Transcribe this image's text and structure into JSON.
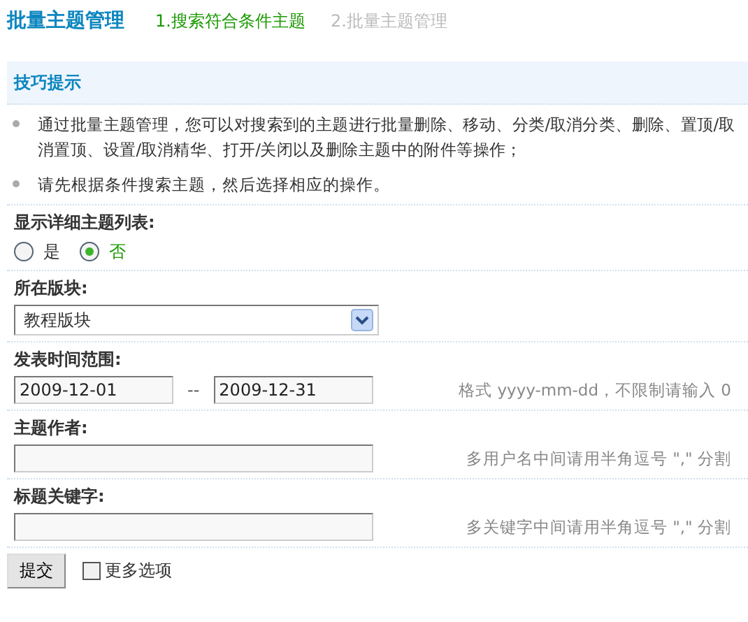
{
  "header": {
    "title": "批量主题管理",
    "steps": [
      {
        "label": "1.搜索符合条件主题",
        "selected": true
      },
      {
        "label": "2.批量主题管理",
        "selected": false
      }
    ]
  },
  "tips": {
    "title": "技巧提示",
    "items": [
      "通过批量主题管理，您可以对搜索到的主题进行批量删除、移动、分类/取消分类、删除、置顶/取消置顶、设置/取消精华、打开/关闭以及删除主题中的附件等操作；",
      "请先根据条件搜索主题，然后选择相应的操作。"
    ]
  },
  "form": {
    "detail_list": {
      "label": "显示详细主题列表:",
      "options": [
        {
          "label": "是",
          "selected": false
        },
        {
          "label": "否",
          "selected": true
        }
      ]
    },
    "forum": {
      "label": "所在版块:",
      "value": "教程版块"
    },
    "date_range": {
      "label": "发表时间范围:",
      "from": "2009-12-01",
      "separator": "--",
      "to": "2009-12-31",
      "hint": "格式 yyyy-mm-dd，不限制请输入 0"
    },
    "author": {
      "label": "主题作者:",
      "hint": "多用户名中间请用半角逗号 \",\" 分割"
    },
    "keywords": {
      "label": "标题关键字:",
      "hint": "多关键字中间请用半角逗号 \",\" 分割"
    }
  },
  "footer": {
    "submit": "提交",
    "more_options": {
      "label": "更多选项",
      "checked": false
    }
  }
}
